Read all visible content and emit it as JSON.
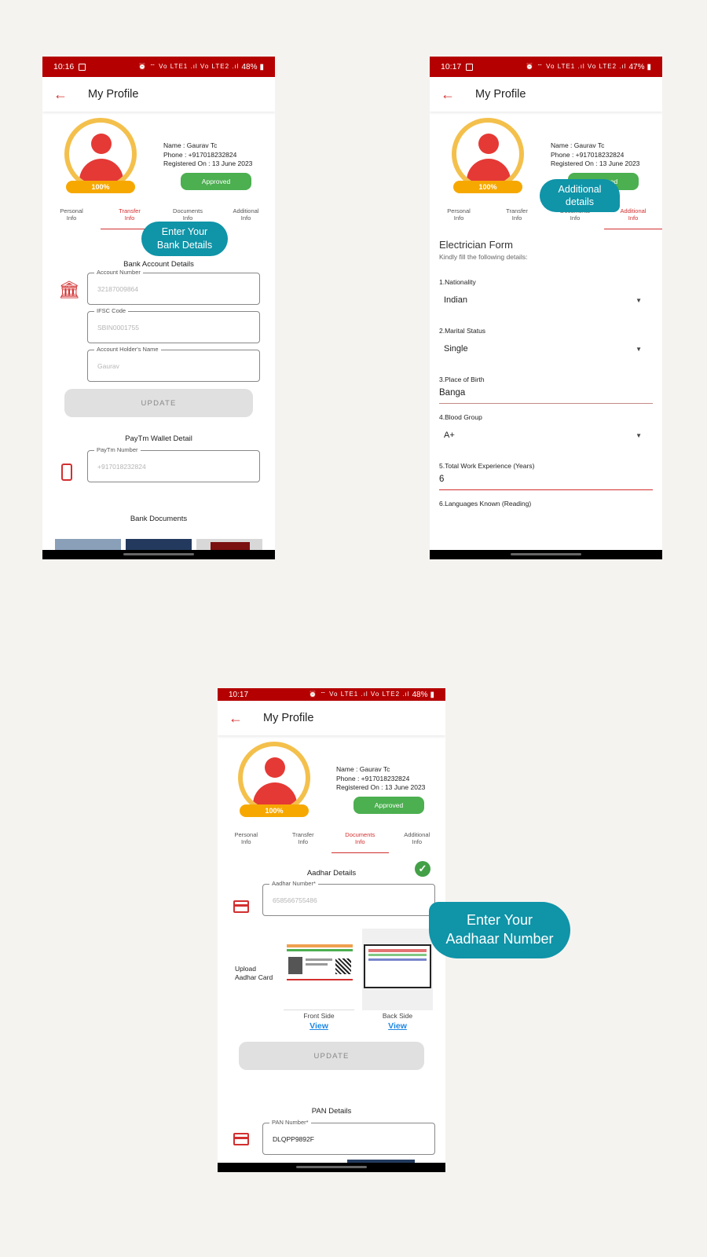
{
  "screen1": {
    "status": {
      "time": "10:16",
      "icons": "⏰ ⌔ Vo LTE1 .ıl Vo LTE2 .ıl",
      "battery": "48%"
    },
    "appbar": {
      "title": "My Profile"
    },
    "profile": {
      "name": "Name : Gaurav Tc",
      "phone": "Phone : +917018232824",
      "registered": "Registered On : 13 June 2023",
      "percent": "100%",
      "status": "Approved"
    },
    "tabs": [
      {
        "line1": "Personal",
        "line2": "Info"
      },
      {
        "line1": "Transfer",
        "line2": "Info"
      },
      {
        "line1": "Documents",
        "line2": "Info"
      },
      {
        "line1": "Additional",
        "line2": "Info"
      }
    ],
    "tooltip": {
      "line1": "Enter Your",
      "line2": "Bank Details"
    },
    "bank": {
      "title": "Bank Account Details",
      "account_label": "Account Number",
      "account_value": "32187009864",
      "ifsc_label": "IFSC Code",
      "ifsc_value": "SBIN0001755",
      "holder_label": "Account Holder's Name",
      "holder_value": "Gaurav",
      "update": "UPDATE"
    },
    "paytm": {
      "title": "PayTm Wallet Detail",
      "label": "PayTm Number",
      "value": "+917018232824"
    },
    "documents": {
      "title": "Bank Documents"
    }
  },
  "screen2": {
    "status": {
      "time": "10:17",
      "icons": "⏰ ⌔ Vo LTE1 .ıl Vo LTE2 .ıl",
      "battery": "47%"
    },
    "appbar": {
      "title": "My Profile"
    },
    "profile": {
      "name": "Name : Gaurav Tc",
      "phone": "Phone : +917018232824",
      "registered": "Registered On : 13 June 2023",
      "percent": "100%",
      "status": "Approved"
    },
    "tabs": [
      {
        "line1": "Personal",
        "line2": "Info"
      },
      {
        "line1": "Transfer",
        "line2": "Info"
      },
      {
        "line1": "Documents",
        "line2": "Info"
      },
      {
        "line1": "Additional",
        "line2": "Info"
      }
    ],
    "tooltip": {
      "line1": "Additional",
      "line2": "details"
    },
    "form": {
      "title": "Electrician Form",
      "subtitle": "Kindly fill the following details:",
      "q1": "1.Nationality",
      "a1": "Indian",
      "q2": "2.Marital Status",
      "a2": "Single",
      "q3": "3.Place of Birth",
      "a3": "Banga",
      "q4": "4.Blood Group",
      "a4": "A+",
      "q5": "5.Total Work Experience (Years)",
      "a5": "6",
      "q6": "6.Languages Known (Reading)"
    }
  },
  "screen3": {
    "status": {
      "time": "10:17",
      "icons": "⏰ ⌔ Vo LTE1 .ıl Vo LTE2 .ıl",
      "battery": "48%"
    },
    "appbar": {
      "title": "My Profile"
    },
    "profile": {
      "name": "Name : Gaurav Tc",
      "phone": "Phone : +917018232824",
      "registered": "Registered On : 13 June 2023",
      "percent": "100%",
      "status": "Approved"
    },
    "tabs": [
      {
        "line1": "Personal",
        "line2": "Info"
      },
      {
        "line1": "Transfer",
        "line2": "Info"
      },
      {
        "line1": "Documents",
        "line2": "Info"
      },
      {
        "line1": "Additional",
        "line2": "Info"
      }
    ],
    "tooltip": {
      "line1": "Enter Your",
      "line2": "Aadhaar Number"
    },
    "aadhar": {
      "title": "Aadhar Details",
      "label": "Aadhar Number*",
      "value": "658566755486",
      "upload_line1": "Upload",
      "upload_line2": "Aadhar Card",
      "front": "Front Side",
      "back": "Back Side",
      "view": "View",
      "update": "UPDATE"
    },
    "pan": {
      "title": "PAN Details",
      "label": "PAN Number*",
      "value": "DLQPP9892F"
    }
  },
  "colors": {
    "brand_red": "#b40000",
    "accent_red": "#d32f2f",
    "approved_green": "#4caf50",
    "tooltip_teal": "#0f94a8",
    "progress_orange": "#f6a800"
  }
}
